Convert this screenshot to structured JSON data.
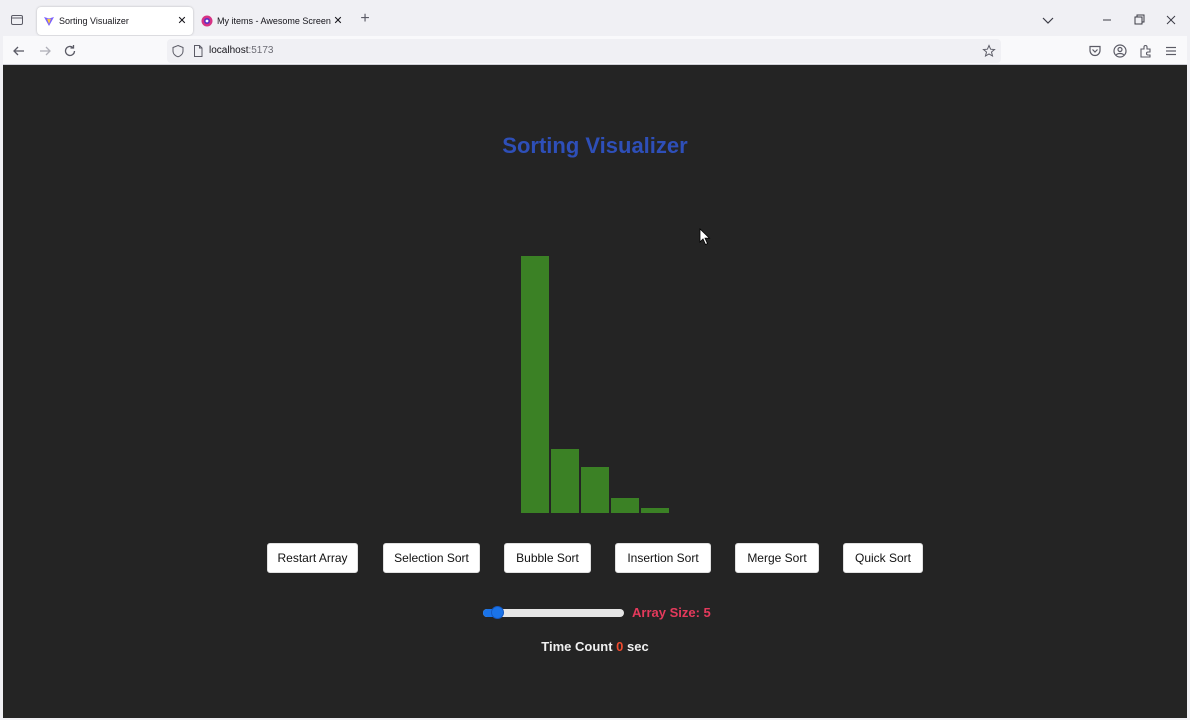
{
  "browser": {
    "tabs": [
      {
        "title": "Sorting Visualizer",
        "active": true,
        "favicon": "vite-icon"
      },
      {
        "title": "My items - Awesome Screensho",
        "active": false,
        "favicon": "awesome-screenshot-icon"
      }
    ],
    "url": {
      "host": "localhost",
      "port": ":5173"
    }
  },
  "page": {
    "title": "Sorting Visualizer",
    "buttons": [
      "Restart Array",
      "Selection Sort",
      "Bubble Sort",
      "Insertion Sort",
      "Merge Sort",
      "Quick Sort"
    ],
    "array_size_label": "Array Size: 5",
    "array_size": 5,
    "slider_fraction": 0.06,
    "time_label_prefix": "Time Count",
    "time_value": "0",
    "time_unit": "sec",
    "array_values": [
      100,
      25,
      18,
      6,
      2
    ]
  },
  "colors": {
    "bar": "#3b8125",
    "title": "#2e4fb8",
    "accent_red": "#e53a5c",
    "slider": "#1a73e8",
    "background": "#242424"
  }
}
